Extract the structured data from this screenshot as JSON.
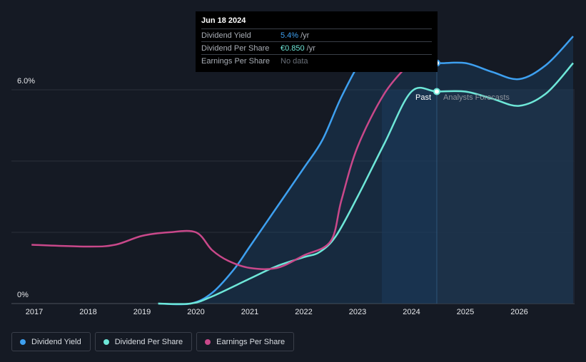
{
  "tooltip": {
    "date": "Jun 18 2024",
    "rows": [
      {
        "label": "Dividend Yield",
        "value": "5.4%",
        "unit": "/yr",
        "color": "#3ea0f0"
      },
      {
        "label": "Dividend Per Share",
        "value": "€0.850",
        "unit": "/yr",
        "color": "#6ee7d8"
      },
      {
        "label": "Earnings Per Share",
        "value": "No data",
        "unit": "",
        "color": "#6a7079"
      }
    ]
  },
  "regions": {
    "past_label": "Past",
    "forecast_label": "Analysts Forecasts"
  },
  "legend": [
    {
      "label": "Dividend Yield",
      "color": "#3ea0f0"
    },
    {
      "label": "Dividend Per Share",
      "color": "#6ee7d8"
    },
    {
      "label": "Earnings Per Share",
      "color": "#c9488a"
    }
  ],
  "chart_data": {
    "type": "line",
    "y_ticks": [
      "6.0%",
      "0%"
    ],
    "ylim": [
      0,
      6.0
    ],
    "x_ticks": [
      "2017",
      "2018",
      "2019",
      "2020",
      "2021",
      "2022",
      "2023",
      "2024",
      "2025",
      "2026"
    ],
    "xlim": [
      2016.95,
      2027.0
    ],
    "past_end": 2024.47,
    "shade_start": 2023.45,
    "series": [
      {
        "name": "Dividend Yield",
        "color": "#3ea0f0",
        "x": [
          2019.3,
          2019.9,
          2020.3,
          2020.7,
          2021.0,
          2021.5,
          2022.0,
          2022.35,
          2022.7,
          2023.1,
          2023.3,
          2023.6,
          2024.0,
          2024.47,
          2025.0,
          2025.5,
          2026.0,
          2026.5,
          2027.0
        ],
        "y": [
          0.0,
          0.0,
          0.3,
          0.95,
          1.6,
          2.7,
          3.8,
          4.6,
          5.8,
          6.9,
          7.0,
          6.95,
          6.85,
          6.75,
          6.75,
          6.5,
          6.3,
          6.7,
          7.5
        ]
      },
      {
        "name": "Dividend Per Share",
        "color": "#6ee7d8",
        "x": [
          2019.3,
          2019.9,
          2020.3,
          2021.0,
          2021.5,
          2022.0,
          2022.3,
          2022.6,
          2023.0,
          2023.5,
          2024.0,
          2024.47,
          2025.0,
          2025.5,
          2026.0,
          2026.5,
          2027.0
        ],
        "y": [
          0.0,
          0.0,
          0.2,
          0.7,
          1.05,
          1.3,
          1.45,
          1.9,
          3.0,
          4.5,
          5.95,
          5.95,
          5.95,
          5.75,
          5.55,
          5.9,
          6.75
        ]
      },
      {
        "name": "Earnings Per Share",
        "color": "#c9488a",
        "x": [
          2016.95,
          2018.0,
          2018.5,
          2019.0,
          2019.5,
          2020.0,
          2020.3,
          2020.6,
          2021.0,
          2021.5,
          2022.0,
          2022.5,
          2022.7,
          2023.0,
          2023.5,
          2024.0
        ],
        "y": [
          1.65,
          1.6,
          1.65,
          1.9,
          2.0,
          2.0,
          1.5,
          1.2,
          1.0,
          1.0,
          1.35,
          1.75,
          2.9,
          4.4,
          5.9,
          6.8
        ]
      }
    ]
  }
}
